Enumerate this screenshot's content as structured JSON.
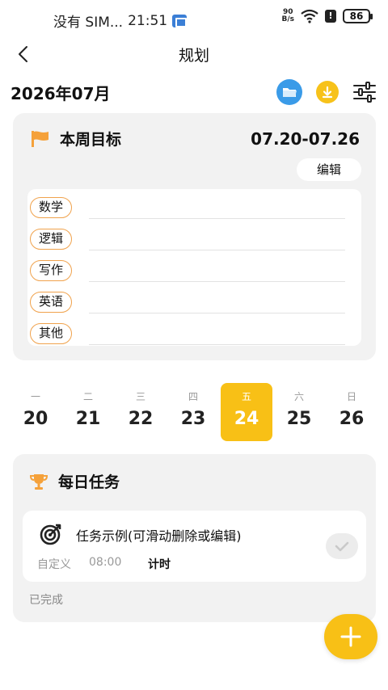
{
  "status_bar": {
    "carrier": "没有 SIM...",
    "time": "21:51",
    "net_speed_value": "90",
    "net_speed_unit": "B/s",
    "battery": "86"
  },
  "nav": {
    "title": "规划",
    "back_icon": "chevron-left-icon"
  },
  "month": {
    "label": "2026年07月",
    "icons": [
      "folder-icon",
      "download-icon",
      "sliders-icon"
    ],
    "colors": {
      "folder": "#3a9be8",
      "download": "#f7c21a"
    }
  },
  "weekly_goal": {
    "title": "本周目标",
    "range": "07.20-07.26",
    "edit_label": "编辑",
    "subjects": [
      {
        "label": "数学"
      },
      {
        "label": "逻辑"
      },
      {
        "label": "写作"
      },
      {
        "label": "英语"
      },
      {
        "label": "其他"
      }
    ]
  },
  "week_days": [
    {
      "weekday": "一",
      "date": "20"
    },
    {
      "weekday": "二",
      "date": "21"
    },
    {
      "weekday": "三",
      "date": "22"
    },
    {
      "weekday": "四",
      "date": "23"
    },
    {
      "weekday": "五",
      "date": "24",
      "selected": true
    },
    {
      "weekday": "六",
      "date": "25"
    },
    {
      "weekday": "日",
      "date": "26"
    }
  ],
  "daily_tasks": {
    "title": "每日任务",
    "items": [
      {
        "name": "任务示例(可滑动删除或编辑)",
        "type": "自定义",
        "time": "08:00",
        "mode": "计时"
      }
    ],
    "completed_label": "已完成"
  },
  "accent_color": "#f8c016"
}
